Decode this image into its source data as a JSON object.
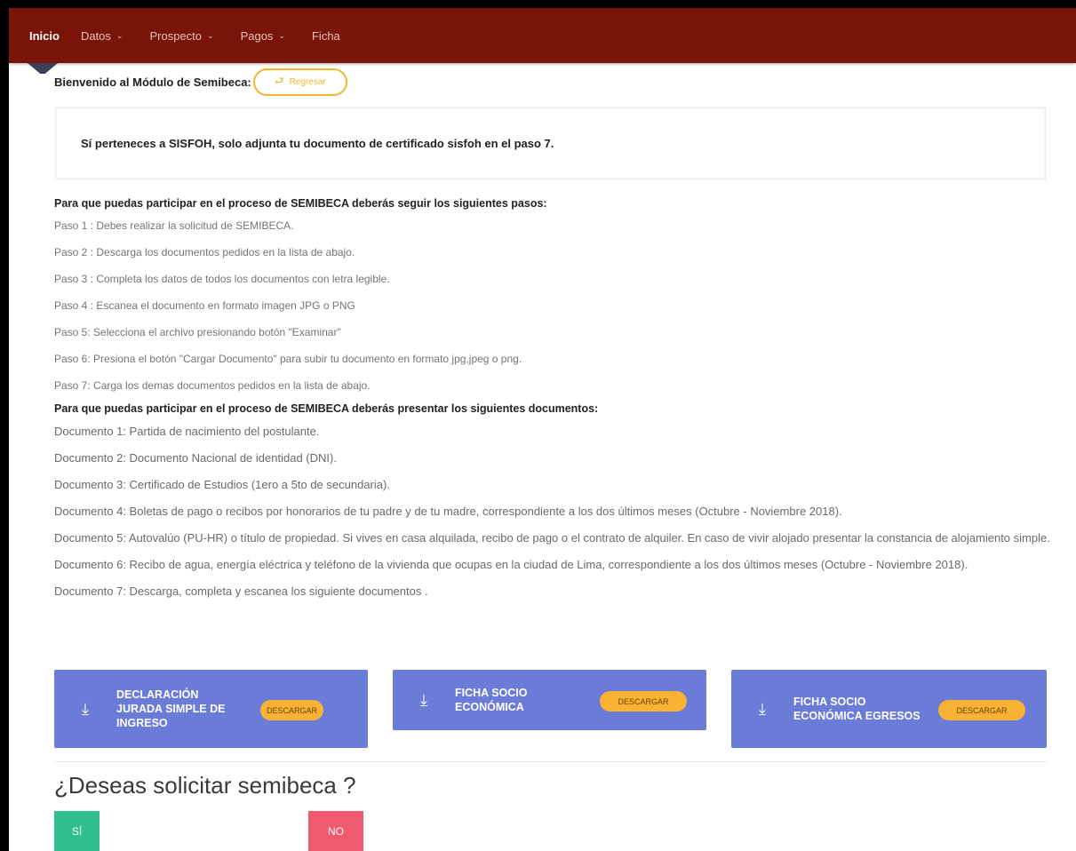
{
  "nav": {
    "items": [
      {
        "label": "Inicio"
      },
      {
        "label": "Datos"
      },
      {
        "label": "Prospecto"
      },
      {
        "label": "Pagos"
      },
      {
        "label": "Ficha"
      }
    ]
  },
  "welcome": {
    "title": "Bienvenido al Módulo de Semibeca:",
    "back_label": "Regresar"
  },
  "notice": {
    "text": "Sí perteneces a SISFOH, solo adjunta tu documento de certificado sisfoh en el paso 7."
  },
  "steps": {
    "heading": "Para que puedas participar en el proceso de SEMIBECA deberás seguir los siguientes pasos:",
    "items": [
      "Paso 1 : Debes realizar la solicitud de SEMIBECA.",
      "Paso 2 : Descarga los documentos pedidos en la lista de abajo.",
      "Paso 3 : Completa los datos de todos los documentos con letra legible.",
      "Paso 4 : Escanea el documento en formato imagen JPG o PNG",
      "Paso 5: Selecciona el archivo presionando botón \"Examinar\"",
      "Paso 6: Presiona el botón \"Cargar Documento\" para subir tu documento en formato jpg,jpeg o png.",
      "Paso 7: Carga los demas documentos pedidos en la lista de abajo."
    ]
  },
  "documents": {
    "heading": "Para que puedas participar en el proceso de SEMIBECA deberás presentar los siguientes documentos:",
    "items": [
      "Documento 1: Partida de nacimiento del postulante.",
      "Documento 2: Documento Nacional de identidad (DNI).",
      "Documento 3: Certificado de Estudios (1ero a 5to de secundaria).",
      "Documento 4: Boletas de pago o recibos por honorarios de tu padre y de tu madre, correspondiente a los dos últimos meses (Octubre - Noviembre 2018).",
      "Documento 5: Autovalúo (PU-HR) o título de propiedad. Si vives en casa alquilada, recibo de pago o el contrato de alquiler. En caso de vivir alojado presentar la constancia de alojamiento simple.",
      "Documento 6: Recibo de agua, energía eléctrica y teléfono de la vivienda que ocupas en la ciudad de Lima, correspondiente a los dos últimos meses (Octubre - Noviembre 2018).",
      "Documento 7: Descarga, completa y escanea los siguiente documentos ."
    ]
  },
  "downloads": [
    {
      "title": "DECLARACIÓN JURADA SIMPLE DE INGRESO",
      "button": "DESCARGAR"
    },
    {
      "title": "FICHA SOCIO ECONÓMICA",
      "button": "DESCARGAR"
    },
    {
      "title": "FICHA SOCIO ECONÓMICA EGRESOS",
      "button": "DESCARGAR"
    }
  ],
  "request": {
    "question": "¿Deseas solicitar semibeca ?",
    "yes_label": "SÍ",
    "no_label": "NO"
  },
  "colors": {
    "navbar": "#781408",
    "card": "#6a7bd8",
    "accent": "#f9b234",
    "yes": "#2fbf8f",
    "no": "#f05a6e"
  },
  "icons": {
    "back": "reply-arrow-icon",
    "download": "download-arrow-icon",
    "nav_dropdown": "chevron-down-icon"
  }
}
